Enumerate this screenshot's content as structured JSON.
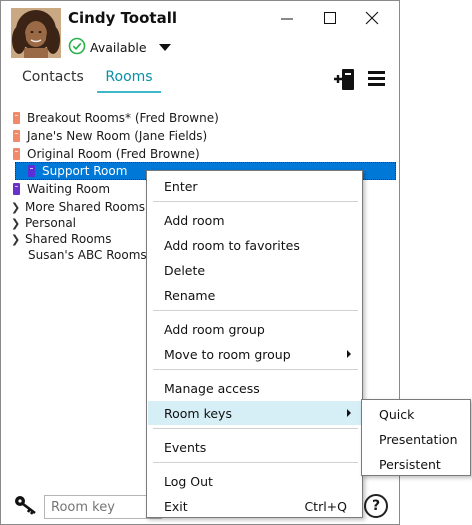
{
  "header": {
    "user_name": "Cindy Tootall",
    "status": "Available",
    "status_color": "#2bb14a"
  },
  "window_controls": [
    "minimize-icon",
    "maximize-icon",
    "close-icon"
  ],
  "tabs": [
    {
      "label": "Contacts",
      "active": false
    },
    {
      "label": "Rooms",
      "active": true
    }
  ],
  "accent_color": "#3fb8c9",
  "toolbar": {
    "icons": [
      "add-room-icon",
      "hamburger-menu-icon"
    ]
  },
  "rooms": [
    {
      "label": "Breakout Rooms* (Fred Browne)",
      "icon_color": "#f08a6b"
    },
    {
      "label": "Jane's New Room (Jane Fields)",
      "icon_color": "#f08a6b"
    },
    {
      "label": "Original Room (Fred Browne)",
      "icon_color": "#f08a6b"
    },
    {
      "label": "Support Room",
      "icon_color": "#5b2fd6",
      "selected": true
    },
    {
      "label": "Waiting Room",
      "icon_color": "#6a32c9"
    }
  ],
  "groups": [
    {
      "label": "More Shared Rooms",
      "collapsible": true
    },
    {
      "label": "Personal",
      "collapsible": true
    },
    {
      "label": "Shared Rooms",
      "collapsible": true
    },
    {
      "label": "Susan's ABC Rooms",
      "collapsible": false
    }
  ],
  "bottom": {
    "room_key_placeholder": "Room key",
    "help_label": "?"
  },
  "context_menu": {
    "items": [
      {
        "label": "Enter"
      },
      {
        "label": "Add room"
      },
      {
        "label": "Add room to favorites"
      },
      {
        "label": "Delete"
      },
      {
        "label": "Rename"
      },
      {
        "label": "Add room group"
      },
      {
        "label": "Move to room group",
        "submenu": true
      },
      {
        "label": "Manage access"
      },
      {
        "label": "Room keys",
        "submenu": true,
        "highlighted": true
      },
      {
        "label": "Events"
      },
      {
        "label": "Log Out"
      },
      {
        "label": "Exit",
        "shortcut": "Ctrl+Q"
      }
    ]
  },
  "room_keys_submenu": {
    "items": [
      {
        "label": "Quick"
      },
      {
        "label": "Presentation"
      },
      {
        "label": "Persistent"
      }
    ]
  }
}
